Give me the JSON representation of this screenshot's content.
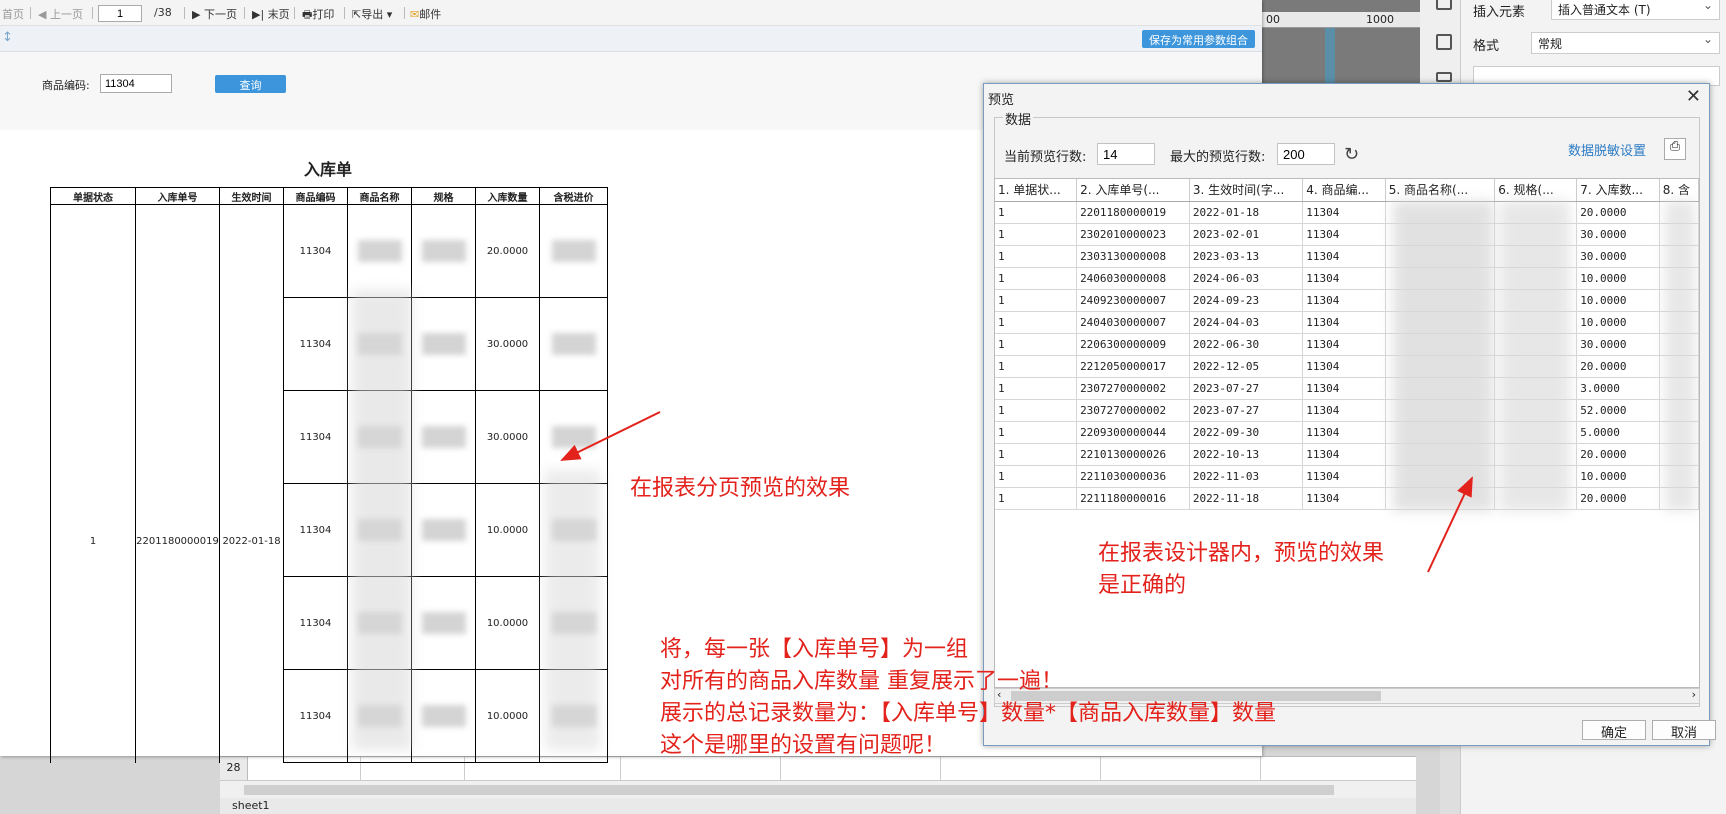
{
  "toolbar": {
    "first_page": "首页",
    "prev_page": "上一页",
    "page_value": "1",
    "page_total": "/38",
    "next_page": "下一页",
    "last_page": "末页",
    "print": "打印",
    "export": "导出",
    "mail": "邮件"
  },
  "param_bar": {
    "save_combo": "保存为常用参数组合"
  },
  "query": {
    "code_label": "商品编码:",
    "code_value": "11304",
    "query_button": "查询"
  },
  "report": {
    "title": "入库单",
    "headers": [
      "单据状态",
      "入库单号",
      "生效时间",
      "商品编码",
      "商品名称",
      "规格",
      "入库数量",
      "含税进价"
    ],
    "group": {
      "status": "1",
      "order_no": "2201180000019",
      "date": "2022-01-18"
    },
    "rows": [
      {
        "code": "11304",
        "qty": "20.0000"
      },
      {
        "code": "11304",
        "qty": "30.0000"
      },
      {
        "code": "11304",
        "qty": "30.0000"
      },
      {
        "code": "11304",
        "qty": "10.0000"
      },
      {
        "code": "11304",
        "qty": "10.0000"
      },
      {
        "code": "11304",
        "qty": "10.0000"
      }
    ]
  },
  "designer": {
    "ruler_labels": [
      "00",
      "1000"
    ],
    "props": {
      "insert_label": "插入元素",
      "insert_value": "插入普通文本 (T)",
      "format_label": "格式",
      "format_value": "常规"
    },
    "sheet_row": "28",
    "sheet_tab": "sheet1"
  },
  "annotations": {
    "page_preview": "在报表分页预览的效果",
    "designer_preview_line1": "在报表设计器内，预览的效果",
    "designer_preview_line2": "是正确的",
    "note_line1": "将，每一张【入库单号】为一组",
    "note_line2": "对所有的商品入库数量 重复展示了一遍！",
    "note_line3": "展示的总记录数量为：【入库单号】数量*【商品入库数量】数量",
    "note_line4": "这个是哪里的设置有问题呢！",
    "color": "#e3221c"
  },
  "preview_dialog": {
    "title": "预览",
    "group_label": "数据",
    "current_rows_label": "当前预览行数:",
    "current_rows_value": "14",
    "max_rows_label": "最大的预览行数:",
    "max_rows_value": "200",
    "mask_link": "数据脱敏设置",
    "columns": [
      "1. 单据状...",
      "2. 入库单号(...",
      "3. 生效时间(字...",
      "4. 商品编...",
      "5. 商品名称(...",
      "6. 规格(...",
      "7. 入库数...",
      "8. 含"
    ],
    "rows": [
      [
        "1",
        "2201180000019",
        "2022-01-18",
        "11304",
        "",
        "",
        "20.0000"
      ],
      [
        "1",
        "2302010000023",
        "2023-02-01",
        "11304",
        "",
        "",
        "30.0000"
      ],
      [
        "1",
        "2303130000008",
        "2023-03-13",
        "11304",
        "",
        "",
        "30.0000"
      ],
      [
        "1",
        "2406030000008",
        "2024-06-03",
        "11304",
        "",
        "",
        "10.0000"
      ],
      [
        "1",
        "2409230000007",
        "2024-09-23",
        "11304",
        "",
        "",
        "10.0000"
      ],
      [
        "1",
        "2404030000007",
        "2024-04-03",
        "11304",
        "",
        "",
        "10.0000"
      ],
      [
        "1",
        "2206300000009",
        "2022-06-30",
        "11304",
        "",
        "",
        "30.0000"
      ],
      [
        "1",
        "2212050000017",
        "2022-12-05",
        "11304",
        "",
        "",
        "20.0000"
      ],
      [
        "1",
        "2307270000002",
        "2023-07-27",
        "11304",
        "",
        "",
        "3.0000"
      ],
      [
        "1",
        "2307270000002",
        "2023-07-27",
        "11304",
        "",
        "",
        "52.0000"
      ],
      [
        "1",
        "2209300000044",
        "2022-09-30",
        "11304",
        "",
        "",
        "5.0000"
      ],
      [
        "1",
        "2210130000026",
        "2022-10-13",
        "11304",
        "",
        "",
        "20.0000"
      ],
      [
        "1",
        "2211030000036",
        "2022-11-03",
        "11304",
        "",
        "",
        "10.0000"
      ],
      [
        "1",
        "2211180000016",
        "2022-11-18",
        "11304",
        "",
        "",
        "20.0000"
      ]
    ],
    "ok": "确定",
    "cancel": "取消"
  }
}
